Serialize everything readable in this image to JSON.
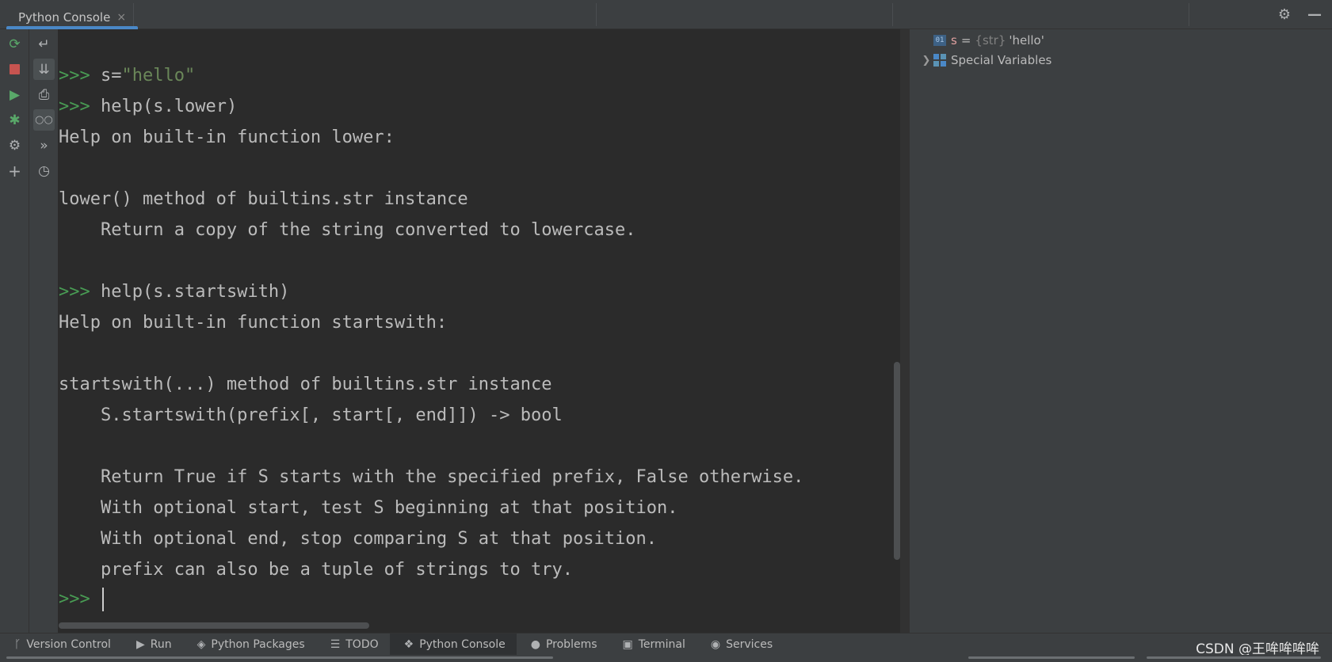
{
  "tab": {
    "title": "Python Console",
    "close": "×"
  },
  "top_icons": [
    "gear-icon",
    "minimize-icon"
  ],
  "toolbar1": [
    "rerun-icon",
    "stop-icon",
    "run-icon",
    "debug-icon",
    "settings-icon",
    "add-icon"
  ],
  "toolbar2": [
    "soft-wrap-icon",
    "scroll-to-end-icon",
    "print-icon",
    "show-variables-icon",
    "execute-history-icon",
    "history-icon"
  ],
  "console": {
    "prompt": ">>>",
    "cmd1_a": "s=",
    "cmd1_b": "\"hello\"",
    "cmd2": "help(s.lower)",
    "out1": "Help on built-in function lower:",
    "out2": "lower() method of builtins.str instance",
    "out3": "    Return a copy of the string converted to lowercase.",
    "cmd3": "help(s.startswith)",
    "out4": "Help on built-in function startswith:",
    "out5": "startswith(...) method of builtins.str instance",
    "out6": "    S.startswith(prefix[, start[, end]]) -> bool",
    "out7": "    Return True if S starts with the specified prefix, False otherwise.",
    "out8": "    With optional start, test S beginning at that position.",
    "out9": "    With optional end, stop comparing S at that position.",
    "out10": "    prefix can also be a tuple of strings to try."
  },
  "variables": {
    "var1": {
      "badge": "01",
      "name": "s",
      "eq": "=",
      "type": "{str}",
      "value": "'hello'"
    },
    "special": {
      "label": "Special Variables"
    }
  },
  "bottom_tabs": [
    {
      "label": "Version Control",
      "icon": "branch-icon"
    },
    {
      "label": "Run",
      "icon": "run-icon"
    },
    {
      "label": "Python Packages",
      "icon": "layers-icon"
    },
    {
      "label": "TODO",
      "icon": "list-icon"
    },
    {
      "label": "Python Console",
      "icon": "python-icon"
    },
    {
      "label": "Problems",
      "icon": "info-icon"
    },
    {
      "label": "Terminal",
      "icon": "terminal-icon"
    },
    {
      "label": "Services",
      "icon": "services-icon"
    }
  ],
  "watermark": "CSDN @王哞哞哞哞"
}
